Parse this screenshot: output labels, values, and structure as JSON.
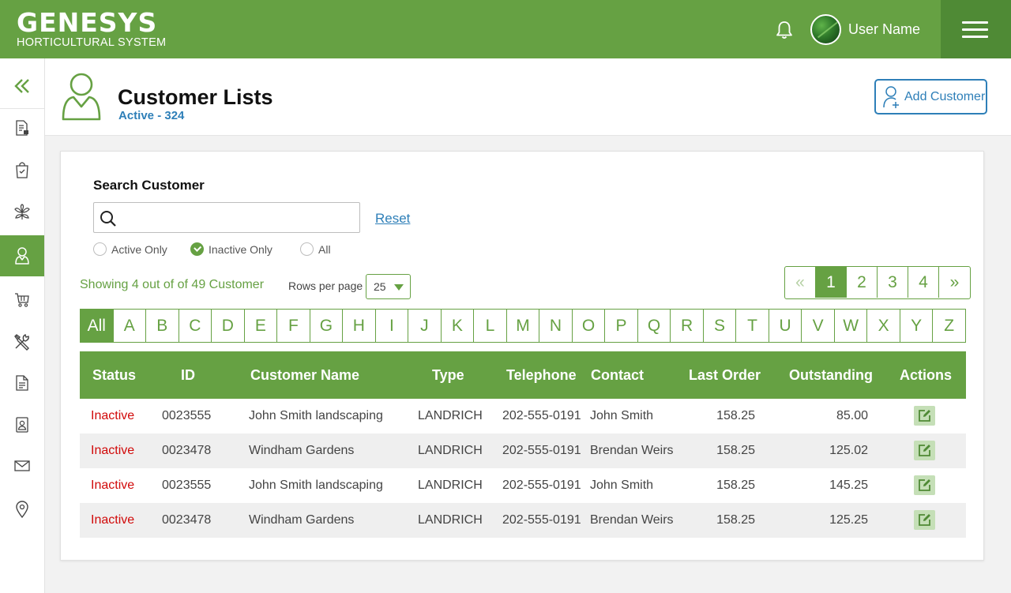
{
  "brand": {
    "name": "GENESYS",
    "subtitle": "HORTICULTURAL SYSTEM"
  },
  "topbar": {
    "user_name": "User Name",
    "notification_icon": "bell-icon",
    "menu_icon": "hamburger-icon"
  },
  "sidebar": {
    "items": [
      {
        "icon": "collapse-double-chevron-icon"
      },
      {
        "icon": "document-icon"
      },
      {
        "icon": "bag-check-icon"
      },
      {
        "icon": "plant-icon"
      },
      {
        "icon": "customer-icon",
        "active": true
      },
      {
        "icon": "cart-icon"
      },
      {
        "icon": "tools-icon"
      },
      {
        "icon": "file-icon"
      },
      {
        "icon": "contact-book-icon"
      },
      {
        "icon": "mail-icon"
      },
      {
        "icon": "location-pin-icon"
      }
    ]
  },
  "header": {
    "title": "Customer Lists",
    "subtitle": "Active - 324",
    "add_button": "Add Customer"
  },
  "search": {
    "label": "Search Customer",
    "value": "",
    "placeholder": "",
    "reset": "Reset",
    "filters": [
      {
        "label": "Active Only",
        "checked": false
      },
      {
        "label": "Inactive Only",
        "checked": true
      },
      {
        "label": "All",
        "checked": false
      }
    ]
  },
  "listing": {
    "showing": "Showing 4 out of of 49 Customer",
    "rows_label": "Rows per page",
    "rows_value": "25"
  },
  "pagination": {
    "first": "«",
    "pages": [
      "1",
      "2",
      "3",
      "4"
    ],
    "current": "1",
    "last": "»"
  },
  "alphabet": [
    "All",
    "A",
    "B",
    "C",
    "D",
    "E",
    "F",
    "G",
    "H",
    "I",
    "J",
    "K",
    "L",
    "M",
    "N",
    "O",
    "P",
    "Q",
    "R",
    "S",
    "T",
    "U",
    "V",
    "W",
    "X",
    "Y",
    "Z"
  ],
  "table": {
    "columns": [
      "Status",
      "ID",
      "Customer Name",
      "Type",
      "Telephone",
      "Contact",
      "Last Order",
      "Outstanding",
      "Actions"
    ],
    "rows": [
      {
        "status": "Inactive",
        "id": "0023555",
        "name": "John Smith landscaping",
        "type": "LANDRICH",
        "phone": "202-555-0191",
        "contact": "John Smith",
        "last_order": "158.25",
        "outstanding": "85.00"
      },
      {
        "status": "Inactive",
        "id": "0023478",
        "name": "Windham Gardens",
        "type": "LANDRICH",
        "phone": "202-555-0191",
        "contact": "Brendan Weirs",
        "last_order": "158.25",
        "outstanding": "125.02"
      },
      {
        "status": "Inactive",
        "id": "0023555",
        "name": "John Smith landscaping",
        "type": "LANDRICH",
        "phone": "202-555-0191",
        "contact": "John Smith",
        "last_order": "158.25",
        "outstanding": "145.25"
      },
      {
        "status": "Inactive",
        "id": "0023478",
        "name": "Windham Gardens",
        "type": "LANDRICH",
        "phone": "202-555-0191",
        "contact": "Brendan Weirs",
        "last_order": "158.25",
        "outstanding": "125.25"
      }
    ]
  },
  "colors": {
    "brand_green": "#66a143",
    "dark_green": "#4f8a35",
    "link_blue": "#2e7fb8",
    "inactive_red": "#d10a0a"
  }
}
